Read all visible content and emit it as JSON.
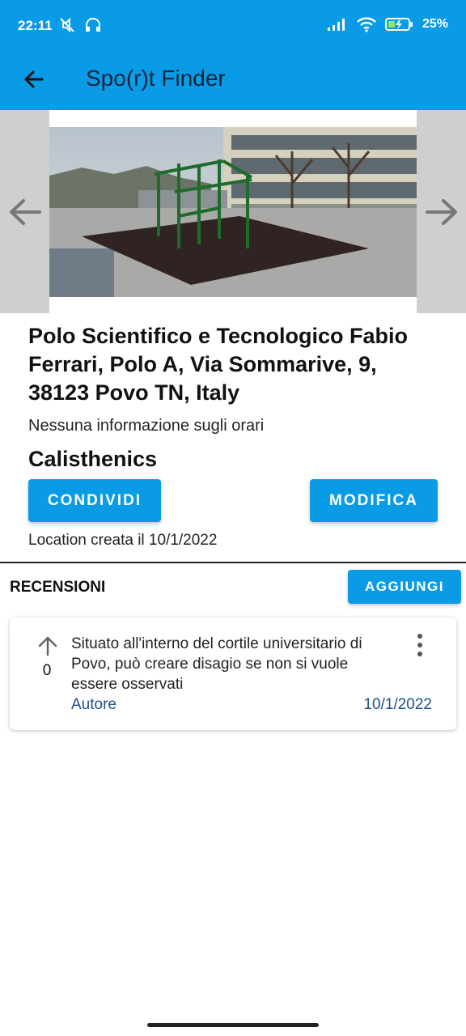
{
  "status_bar": {
    "time": "22:11",
    "battery": "25%",
    "background_color": "#0a9be6"
  },
  "app_bar": {
    "title": "Spo(r)t Finder"
  },
  "location": {
    "title": "Polo Scientifico e Tecnologico Fabio Ferrari, Polo A, Via Sommarive, 9, 38123 Povo TN, Italy",
    "hours": "Nessuna informazione sugli orari",
    "sport": "Calisthenics",
    "created": "Location creata il 10/1/2022"
  },
  "buttons": {
    "share": "CONDIVIDI",
    "edit": "MODIFICA",
    "add_review": "AGGIUNGI"
  },
  "reviews": {
    "title": "RECENSIONI",
    "items": [
      {
        "votes": "0",
        "text": "Situato all'interno del cortile universitario di Povo, può creare disagio se non si vuole essere osservati",
        "author": "Autore",
        "date": "10/1/2022"
      }
    ]
  },
  "colors": {
    "accent": "#0a9be6",
    "link": "#1e4f8f"
  }
}
